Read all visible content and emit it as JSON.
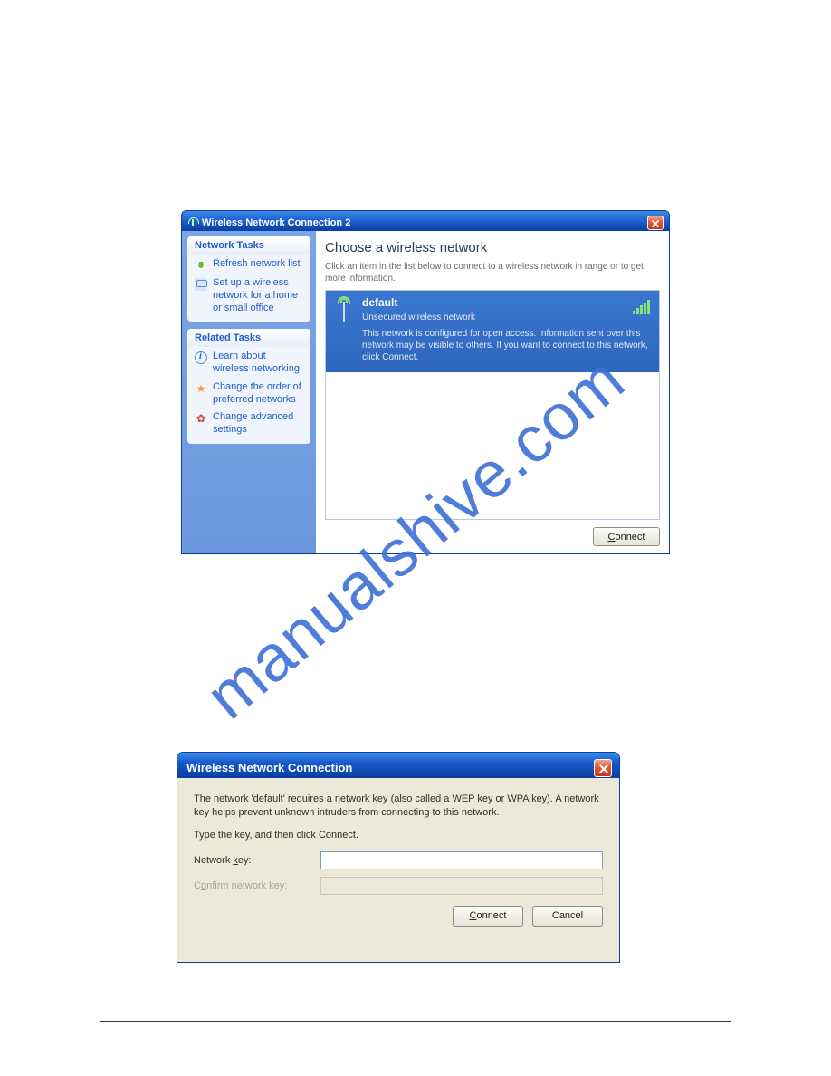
{
  "watermark": "manualshive.com",
  "window1": {
    "title": "Wireless Network Connection 2",
    "sidebar": {
      "networkTasks": {
        "header": "Network Tasks",
        "refresh": "Refresh network list",
        "setup": "Set up a wireless network for a home or small office"
      },
      "relatedTasks": {
        "header": "Related Tasks",
        "learn": "Learn about wireless networking",
        "order": "Change the order of preferred networks",
        "advanced": "Change advanced settings"
      }
    },
    "main": {
      "heading": "Choose a wireless network",
      "subtext": "Click an item in the list below to connect to a wireless network in range or to get more information.",
      "selected": {
        "name": "default",
        "status": "Unsecured wireless network",
        "desc": "This network is configured for open access. Information sent over this network may be visible to others. If you want to connect to this network, click Connect."
      },
      "connect_label": "Connect",
      "connect_u": "C",
      "connect_rest": "onnect"
    }
  },
  "window2": {
    "title": "Wireless Network Connection",
    "p1": "The network 'default' requires a network key (also called a WEP key or WPA key). A network key helps prevent unknown intruders from connecting to this network.",
    "p2": "Type the key, and then click Connect.",
    "label_key_pre": "Network ",
    "label_key_u": "k",
    "label_key_post": "ey:",
    "label_confirm_pre": "C",
    "label_confirm_u": "o",
    "label_confirm_post": "nfirm network key:",
    "key_value": "",
    "connect_u": "C",
    "connect_rest": "onnect",
    "cancel": "Cancel"
  }
}
